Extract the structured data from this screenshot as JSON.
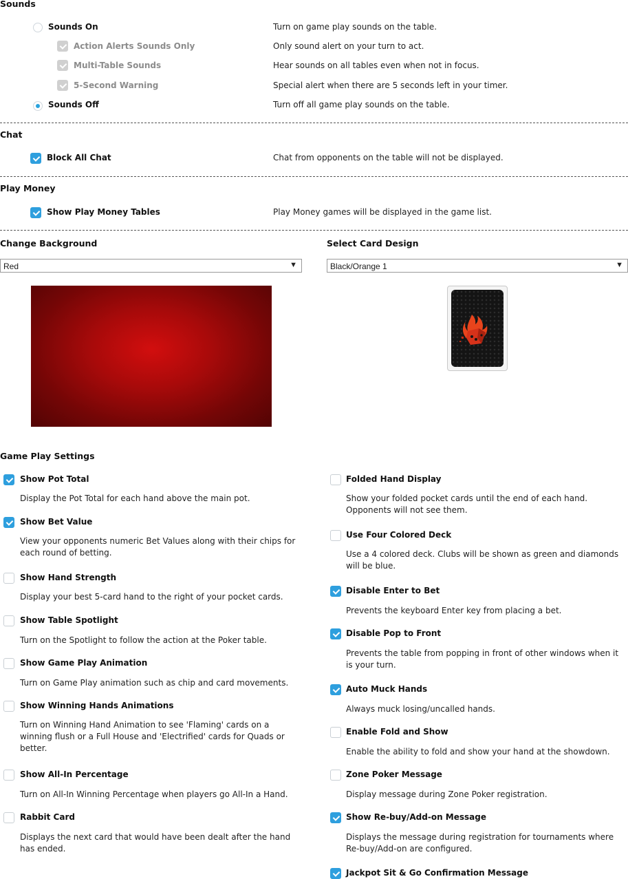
{
  "sounds": {
    "title": "Sounds",
    "rows": [
      {
        "label": "Sounds On",
        "desc": "Turn on game play sounds on the table."
      },
      {
        "label": "Action Alerts Sounds Only",
        "desc": "Only sound alert on your turn to act."
      },
      {
        "label": "Multi-Table Sounds",
        "desc": "Hear sounds on all tables even when not in focus."
      },
      {
        "label": "5-Second Warning",
        "desc": "Special alert when there are 5 seconds left in your timer."
      },
      {
        "label": "Sounds Off",
        "desc": "Turn off all game play sounds on the table."
      }
    ],
    "selected": "Sounds Off"
  },
  "chat": {
    "title": "Chat",
    "label": "Block All Chat",
    "desc": "Chat from opponents on the table will not be displayed.",
    "checked": true
  },
  "play_money": {
    "title": "Play Money",
    "label": "Show Play Money Tables",
    "desc": "Play Money games will be displayed in the game list.",
    "checked": true
  },
  "background": {
    "title": "Change Background",
    "selected": "Red",
    "arrow": "▼"
  },
  "card_design": {
    "title": "Select Card Design",
    "selected": "Black/Orange 1",
    "arrow": "▼"
  },
  "game_play": {
    "title": "Game Play Settings",
    "left": [
      {
        "label": "Show Pot Total",
        "desc": "Display the Pot Total for each hand above the main pot.",
        "checked": true
      },
      {
        "label": "Show Bet Value",
        "desc": "View your opponents numeric Bet Values along with their chips for each round of betting.",
        "checked": true
      },
      {
        "label": "Show Hand Strength",
        "desc": "Display your best 5-card hand to the right of your pocket cards.",
        "checked": false
      },
      {
        "label": "Show Table Spotlight",
        "desc": "Turn on the Spotlight to follow the action at the Poker table.",
        "checked": false
      },
      {
        "label": "Show Game Play Animation",
        "desc": "Turn on Game Play animation such as chip and card movements.",
        "checked": false
      },
      {
        "label": "Show Winning Hands Animations",
        "desc": "Turn on Winning Hand Animation to see 'Flaming' cards on a winning flush or a Full House and 'Electrified' cards for Quads or better.",
        "checked": false
      },
      {
        "label": "Show All-In Percentage",
        "desc": "Turn on All-In Winning Percentage when players go All-In a Hand.",
        "checked": false
      },
      {
        "label": "Rabbit Card",
        "desc": "Displays the next card that would have been dealt after the hand has ended.",
        "checked": false
      }
    ],
    "right": [
      {
        "label": "Folded Hand Display",
        "desc": "Show your folded pocket cards until the end of each hand. Opponents will not see them.",
        "checked": false
      },
      {
        "label": "Use Four Colored Deck",
        "desc": "Use a 4 colored deck. Clubs will be shown as green and diamonds will be blue.",
        "checked": false
      },
      {
        "label": "Disable Enter to Bet",
        "desc": "Prevents the keyboard Enter key from placing a bet.",
        "checked": true
      },
      {
        "label": "Disable Pop to Front",
        "desc": "Prevents the table from popping in front of other windows when it is your turn.",
        "checked": true
      },
      {
        "label": "Auto Muck Hands",
        "desc": "Always muck losing/uncalled hands.",
        "checked": true
      },
      {
        "label": "Enable Fold and Show",
        "desc": "Enable the ability to fold and show your hand at the showdown.",
        "checked": false
      },
      {
        "label": "Zone Poker Message",
        "desc": "Display message during Zone Poker registration.",
        "checked": false
      },
      {
        "label": "Show Re-buy/Add-on Message",
        "desc": "Displays the message during registration for tournaments where Re-buy/Add-on are configured.",
        "checked": true
      },
      {
        "label": "Jackpot Sit & Go Confirmation Message",
        "desc": "",
        "checked": true
      }
    ]
  },
  "colors": {
    "accent": "#2e9fde",
    "disabled": "#d0d0d0",
    "table_red": "#c40c0c"
  }
}
